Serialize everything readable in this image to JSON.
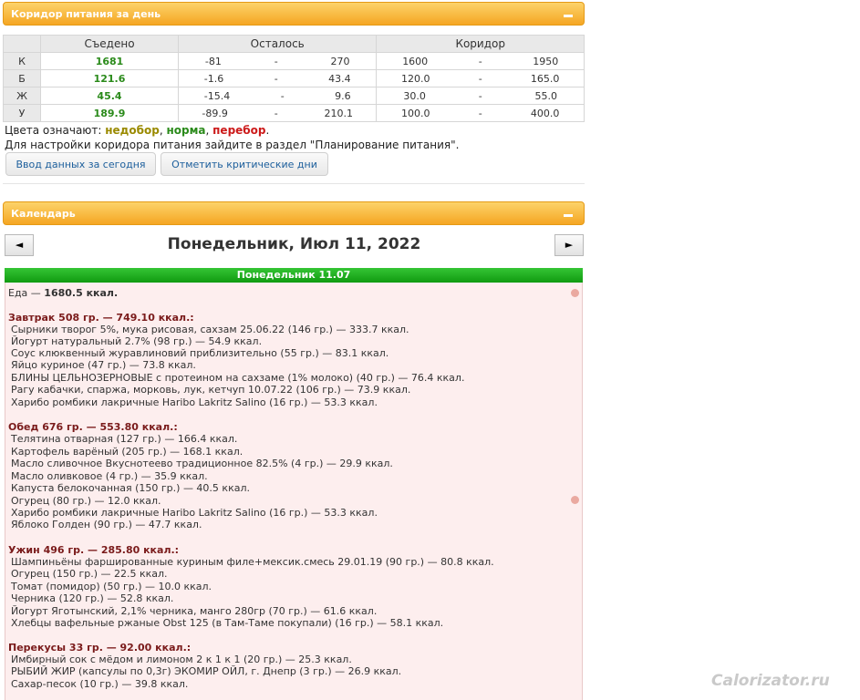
{
  "corridor_panel": {
    "title": "Коридор питания за день",
    "headers": {
      "eaten": "Съедено",
      "left": "Осталось",
      "corridor": "Коридор"
    },
    "rows": [
      {
        "label": "К",
        "eaten": "1681",
        "left_min": "-81",
        "dash": "-",
        "left_max": "270",
        "cor_min": "1600",
        "cor_max": "1950"
      },
      {
        "label": "Б",
        "eaten": "121.6",
        "left_min": "-1.6",
        "dash": "-",
        "left_max": "43.4",
        "cor_min": "120.0",
        "cor_max": "165.0"
      },
      {
        "label": "Ж",
        "eaten": "45.4",
        "left_min": "-15.4",
        "dash": "-",
        "left_max": "9.6",
        "cor_min": "30.0",
        "cor_max": "55.0"
      },
      {
        "label": "У",
        "eaten": "189.9",
        "left_min": "-89.9",
        "dash": "-",
        "left_max": "210.1",
        "cor_min": "100.0",
        "cor_max": "400.0"
      }
    ],
    "legend_prefix": "Цвета означают: ",
    "legend_lack": "недобор",
    "comma": ", ",
    "legend_norm": "норма",
    "legend_over": "перебор",
    "period": ".",
    "hint": "Для настройки коридора питания зайдите в раздел \"Планирование питания\".",
    "button_today": "Ввод данных за сегодня",
    "button_critical": "Отметить критические дни"
  },
  "calendar_panel": {
    "title": "Календарь",
    "prev": "◄",
    "next": "►",
    "date": "Понедельник, Июл 11, 2022",
    "day_label": "Понедельник 11.07",
    "food_prefix": "Еда — ",
    "food_total": "1680.5 ккал.",
    "meals": [
      {
        "header": "Завтрак 508 гр. — 749.10 ккал.:",
        "items": [
          "Сырники творог 5%, мука рисовая, сахзам 25.06.22 (146 гр.) — 333.7 ккал.",
          "Йогурт натуральный 2.7% (98 гр.) — 54.9 ккал.",
          "Соус клюквенный журавлиновий приблизительно (55 гр.) — 83.1 ккал.",
          "Яйцо куриное (47 гр.) — 73.8 ккал.",
          "БЛИНЫ ЦЕЛЬНОЗЕРНОВЫЕ с протеином на сахзаме (1% молоко) (40 гр.) — 76.4 ккал.",
          "Рагу кабачки, спаржа, морковь, лук, кетчуп 10.07.22 (106 гр.) — 73.9 ккал.",
          "Харибо ромбики лакричные Haribo Lakritz Salino (16 гр.) — 53.3 ккал."
        ]
      },
      {
        "header": "Обед 676 гр. — 553.80 ккал.:",
        "items": [
          "Телятина отварная (127 гр.) — 166.4 ккал.",
          "Картофель варёный (205 гр.) — 168.1 ккал.",
          "Масло сливочное Вкуснотеево традиционное 82.5% (4 гр.) — 29.9 ккал.",
          "Масло оливковое (4 гр.) — 35.9 ккал.",
          "Капуста белокочанная (150 гр.) — 40.5 ккал.",
          "Огурец (80 гр.) — 12.0 ккал.",
          "Харибо ромбики лакричные Haribo Lakritz Salino (16 гр.) — 53.3 ккал.",
          "Яблоко Голден (90 гр.) — 47.7 ккал."
        ]
      },
      {
        "header": "Ужин 496 гр. — 285.80 ккал.:",
        "items": [
          "Шампиньёны фаршированные куриным филе+мексик.смесь 29.01.19 (90 гр.) — 80.8 ккал.",
          "Огурец (150 гр.) — 22.5 ккал.",
          "Томат (помидор) (50 гр.) — 10.0 ккал.",
          "Черника (120 гр.) — 52.8 ккал.",
          "Йогурт Яготынский, 2,1% черника, манго 280гр (70 гр.) — 61.6 ккал.",
          "Хлебцы вафельные ржаные Obst 125 (в Там-Таме покупали) (16 гр.) — 58.1 ккал."
        ]
      },
      {
        "header": "Перекусы 33 гр. — 92.00 ккал.:",
        "items": [
          "Имбирный сок с мёдом и лимоном 2 к 1 к 1 (20 гр.) — 25.3 ккал.",
          "РЫБИЙ ЖИР (капсулы по 0,3г) ЭКОМИР ОЙЛ, г. Днепр (3 гр.) — 26.9 ккал.",
          "Сахар-песок (10 гр.) — 39.8 ккал."
        ]
      }
    ]
  },
  "watermark": "Calorizator.ru"
}
